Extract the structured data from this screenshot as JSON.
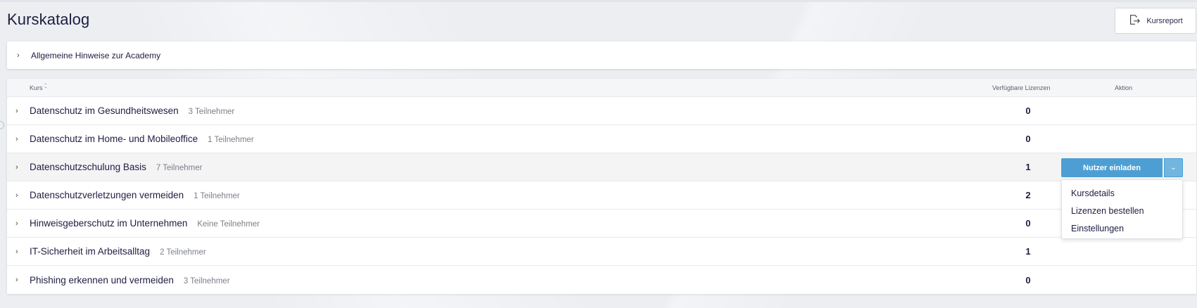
{
  "page": {
    "title": "Kurskatalog"
  },
  "header": {
    "report_label": "Kursreport"
  },
  "hints": {
    "label": "Allgemeine Hinweise zur Academy"
  },
  "table": {
    "columns": {
      "course": "Kurs",
      "licenses": "Verfügbare Lizenzen",
      "action": "Aktion"
    },
    "rows": [
      {
        "name": "Datenschutz im Gesundheitswesen",
        "participants": "3 Teilnehmer",
        "licenses": "0"
      },
      {
        "name": "Datenschutz im Home- und Mobileoffice",
        "participants": "1 Teilnehmer",
        "licenses": "0"
      },
      {
        "name": "Datenschutzschulung Basis",
        "participants": "7 Teilnehmer",
        "licenses": "1"
      },
      {
        "name": "Datenschutzverletzungen vermeiden",
        "participants": "1 Teilnehmer",
        "licenses": "2"
      },
      {
        "name": "Hinweisgeberschutz im Unternehmen",
        "participants": "Keine Teilnehmer",
        "licenses": "0"
      },
      {
        "name": "IT-Sicherheit im Arbeitsalltag",
        "participants": "2 Teilnehmer",
        "licenses": "1"
      },
      {
        "name": "Phishing erkennen und vermeiden",
        "participants": "3 Teilnehmer",
        "licenses": "0"
      }
    ]
  },
  "action": {
    "invite_label": "Nutzer einladen",
    "menu": [
      "Kursdetails",
      "Lizenzen bestellen",
      "Einstellungen"
    ]
  },
  "colors": {
    "primary": "#4d9fd3",
    "primary_light": "#71b6e0",
    "text": "#1d1d42",
    "muted": "#7a7f88"
  },
  "icons": {
    "report": "export-icon",
    "expand": "chevron-right-icon",
    "sort": "sort-icon",
    "dropdown": "chevron-down-icon"
  }
}
